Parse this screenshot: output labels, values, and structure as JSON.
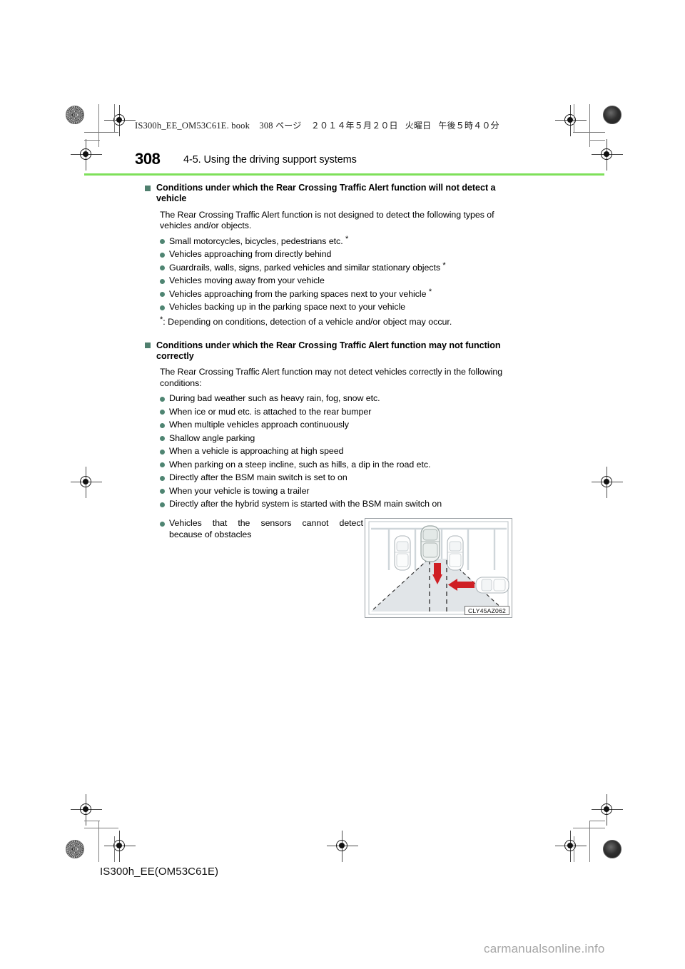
{
  "header": {
    "book_line": "IS300h_EE_OM53C61E. book",
    "page_label": "308",
    "page_unit": "ページ",
    "date": "２０１４年５月２０日",
    "weekday": "火曜日",
    "time": "午後５時４０分"
  },
  "page": {
    "number": "308",
    "section_title": "4-5. Using the driving support systems",
    "rule_color": "#7ee05a",
    "accent_color": "#4f7f6e"
  },
  "sections": [
    {
      "heading": "Conditions under which the Rear Crossing Traffic Alert function will not detect a vehicle",
      "intro": "The Rear Crossing Traffic Alert function is not designed to detect the following types of vehicles and/or objects.",
      "items": [
        {
          "text": "Small motorcycles, bicycles, pedestrians etc.",
          "star": true,
          "star_spaced": true
        },
        {
          "text": "Vehicles approaching from directly behind",
          "star": false
        },
        {
          "text": "Guardrails, walls, signs, parked vehicles and similar stationary objects",
          "star": true
        },
        {
          "text": "Vehicles moving away from your vehicle",
          "star": false
        },
        {
          "text": "Vehicles approaching from the parking spaces next to your vehicle",
          "star": true
        },
        {
          "text": "Vehicles backing up in the parking space next to your vehicle",
          "star": false
        }
      ],
      "footnote": ": Depending on conditions, detection of a vehicle and/or object may occur."
    },
    {
      "heading": "Conditions under which the Rear Crossing Traffic Alert function may not function correctly",
      "intro": "The Rear Crossing Traffic Alert function may not detect vehicles correctly in the following conditions:",
      "items": [
        {
          "text": "During bad weather such as heavy rain, fog, snow etc.",
          "star": false
        },
        {
          "text": "When ice or mud etc. is attached to the rear bumper",
          "star": false
        },
        {
          "text": "When multiple vehicles approach continuously",
          "star": false
        },
        {
          "text": "Shallow angle parking",
          "star": false
        },
        {
          "text": "When a vehicle is approaching at high speed",
          "star": false
        },
        {
          "text": "When parking on a steep incline, such as hills, a dip in the road etc.",
          "star": false
        },
        {
          "text": "Directly after the BSM main switch is set to on",
          "star": false
        },
        {
          "text": "When your vehicle is towing a trailer",
          "star": false
        },
        {
          "text": "Directly after the hybrid system is started with the BSM main switch on",
          "star": false
        }
      ]
    }
  ],
  "final_item": {
    "line1_words": [
      "Vehicles",
      "that",
      "the",
      "sensors",
      "cannot",
      "detect"
    ],
    "line2": "because of obstacles"
  },
  "figure": {
    "code": "CLY45AZ062",
    "alt": "Top-down parking lot diagram: vehicle backing out of a parking space with rear crossing traffic detection zone and an approaching vehicle"
  },
  "footer": {
    "code": "IS300h_EE(OM53C61E)",
    "watermark": "carmanualsonline.info"
  }
}
